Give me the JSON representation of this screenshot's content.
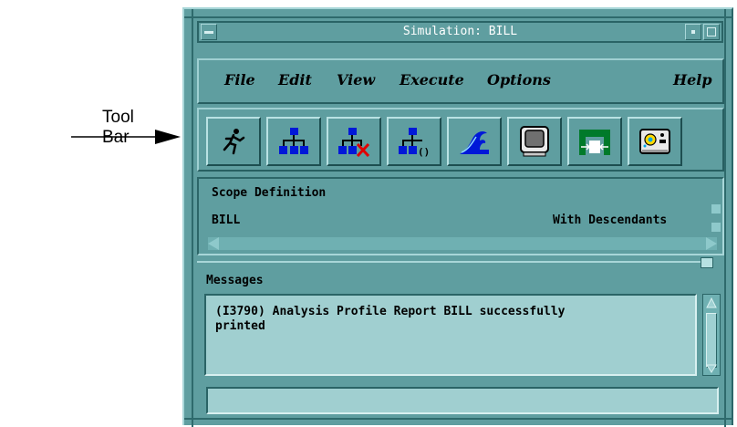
{
  "annotation": {
    "line1": "Tool",
    "line2": "Bar"
  },
  "window": {
    "title": "Simulation: BILL"
  },
  "menu": [
    {
      "label": "File",
      "icon": ""
    },
    {
      "label": "Edit"
    },
    {
      "label": "View"
    },
    {
      "label": "Execute"
    },
    {
      "label": "Options"
    },
    {
      "label": "Help"
    }
  ],
  "toolbar": [
    {
      "icon": "run-icon"
    },
    {
      "icon": "hierarchy-icon"
    },
    {
      "icon": "hierarchy-delete-icon"
    },
    {
      "icon": "hierarchy-params-icon"
    },
    {
      "icon": "wave-icon"
    },
    {
      "icon": "monitor-icon"
    },
    {
      "icon": "connector-icon"
    },
    {
      "icon": "control-panel-icon"
    }
  ],
  "scope": {
    "heading": "Scope Definition",
    "name": "BILL",
    "mode": "With Descendants"
  },
  "messages": {
    "heading": "Messages",
    "text": "(I3790) Analysis Profile Report BILL successfully\nprinted"
  },
  "status": {
    "text": ""
  }
}
